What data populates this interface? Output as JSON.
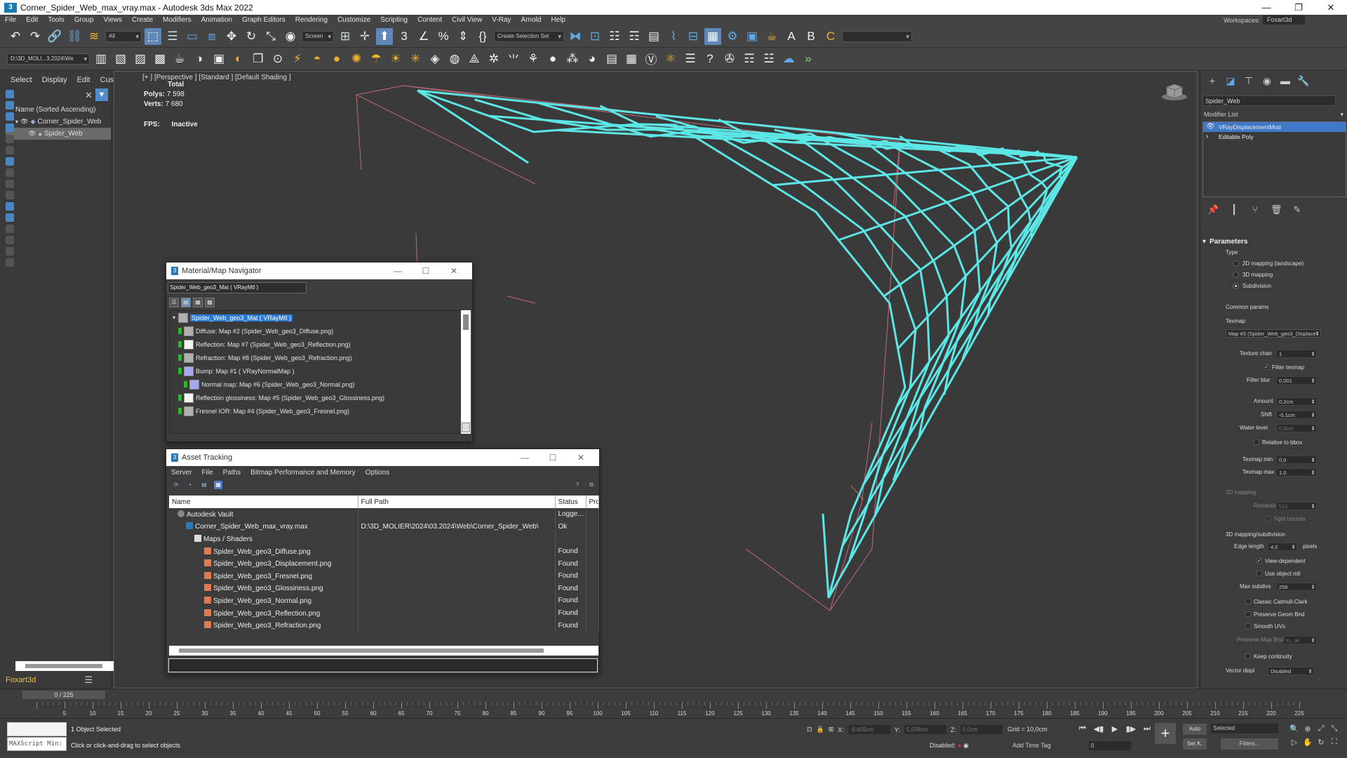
{
  "window": {
    "title": "Corner_Spider_Web_max_vray.max - Autodesk 3ds Max 2022",
    "workspaces_label": "Workspaces:",
    "workspace_value": "Foxart3d"
  },
  "menu": [
    "File",
    "Edit",
    "Tools",
    "Group",
    "Views",
    "Create",
    "Modifiers",
    "Animation",
    "Graph Editors",
    "Rendering",
    "Customize",
    "Scripting",
    "Content",
    "Civil View",
    "V-Ray",
    "Arnold",
    "Help"
  ],
  "toolbar": {
    "filter_all": "All",
    "coord_screen": "Screen",
    "selection_set": "Create Selection Set",
    "path_box": "D:\\3D_MOLI...3.2024\\We"
  },
  "scene_explorer": {
    "tabs": [
      "Select",
      "Display",
      "Edit",
      "Customize"
    ],
    "sort_label": "Name (Sorted Ascending)",
    "items": [
      "Corner_Spider_Web",
      "Spider_Web"
    ],
    "footer": "Foxart3d"
  },
  "viewport": {
    "label": "[+ ] [Perspective ] [Standard ] [Default Shading ]",
    "stats_total": "Total",
    "polys_label": "Polys:",
    "polys_value": "7 598",
    "verts_label": "Verts:",
    "verts_value": "7 680",
    "fps_label": "FPS:",
    "fps_value": "Inactive",
    "wire_color": "#5ce6e6"
  },
  "material_navigator": {
    "title": "Material/Map Navigator",
    "name_box": "Spider_Web_geo3_Mat  ( VRayMtl )",
    "items": [
      "Spider_Web_geo3_Mat  ( VRayMtl )",
      "Diffuse: Map #2 (Spider_Web_geo3_Diffuse.png)",
      "Reflection: Map #7 (Spider_Web_geo3_Reflection.png)",
      "Refraction: Map #8 (Spider_Web_geo3_Refraction.png)",
      "Bump: Map #1  ( VRayNormalMap )",
      "Normal map: Map #6 (Spider_Web_geo3_Normal.png)",
      "Reflection glossiness: Map #5 (Spider_Web_geo3_Glossiness.png)",
      "Fresnel IOR: Map #4 (Spider_Web_geo3_Fresnel.png)"
    ]
  },
  "asset_tracking": {
    "title": "Asset Tracking",
    "menu": [
      "Server",
      "File",
      "Paths",
      "Bitmap Performance and Memory",
      "Options"
    ],
    "columns": [
      "Name",
      "Full Path",
      "Status",
      "Pro"
    ],
    "rows": [
      {
        "name": "Autodesk Vault",
        "path": "",
        "status": "Logge..."
      },
      {
        "name": "Corner_Spider_Web_max_vray.max",
        "path": "D:\\3D_MOLIER\\2024\\03.2024\\Web\\Corner_Spider_Web\\",
        "status": "Ok"
      },
      {
        "name": "Maps / Shaders",
        "path": "",
        "status": ""
      },
      {
        "name": "Spider_Web_geo3_Diffuse.png",
        "path": "",
        "status": "Found"
      },
      {
        "name": "Spider_Web_geo3_Displacement.png",
        "path": "",
        "status": "Found"
      },
      {
        "name": "Spider_Web_geo3_Fresnel.png",
        "path": "",
        "status": "Found"
      },
      {
        "name": "Spider_Web_geo3_Glossiness.png",
        "path": "",
        "status": "Found"
      },
      {
        "name": "Spider_Web_geo3_Normal.png",
        "path": "",
        "status": "Found"
      },
      {
        "name": "Spider_Web_geo3_Reflection.png",
        "path": "",
        "status": "Found"
      },
      {
        "name": "Spider_Web_geo3_Refraction.png",
        "path": "",
        "status": "Found"
      }
    ]
  },
  "command_panel": {
    "object_name": "Spider_Web",
    "modifier_list": "Modifier List",
    "stack": [
      "VRayDisplacementMod",
      "Editable Poly"
    ],
    "parameters": "Parameters",
    "type_label": "Type",
    "type_options": [
      "2D mapping (landscape)",
      "3D mapping",
      "Subdivision"
    ],
    "common_params": "Common params",
    "texmap_label": "Texmap",
    "texmap_value": "Map #3 (Spider_Web_geo3_Displace",
    "texture_chan_label": "Texture chan",
    "texture_chan_value": "1",
    "filter_texmap": "Filter texmap",
    "filter_blur_label": "Filter blur",
    "filter_blur_value": "0,001",
    "amount_label": "Amount",
    "amount_value": "0,2cm",
    "shift_label": "Shift",
    "shift_value": "-0,1cm",
    "water_level_label": "Water level",
    "water_level_value": "0,0cm",
    "relative_bbox": "Relative to bbox",
    "texmap_min_label": "Texmap min",
    "texmap_min_value": "0,0",
    "texmap_max_label": "Texmap max",
    "texmap_max_value": "1,0",
    "mapping2d_label": "2D mapping",
    "resolution_label": "Resolution",
    "resolution_value": "512",
    "tight_bounds": "Tight bounds",
    "mapping3d_label": "3D mapping/subdivision",
    "edge_length_label": "Edge length",
    "edge_length_value": "4,0",
    "pixels_label": "pixels",
    "view_dependent": "View-dependent",
    "use_object_mtl": "Use object mtl",
    "max_subdivs_label": "Max subdivs",
    "max_subdivs_value": "256",
    "classic_catmull": "Classic Catmull-Clark",
    "preserve_geom": "Preserve Geom Bnd",
    "smooth_uvs": "Smooth UVs",
    "preserve_map_label": "Preserve Map Bnd",
    "preserve_map_value": "In...al",
    "keep_continuity": "Keep continuity",
    "vector_displ_label": "Vector displ",
    "vector_displ_value": "Disabled"
  },
  "timeline": {
    "slider": "0 / 225",
    "ticks": [
      "0",
      "5",
      "10",
      "15",
      "20",
      "25",
      "30",
      "35",
      "40",
      "45",
      "50",
      "55",
      "60",
      "65",
      "70",
      "75",
      "80",
      "85",
      "90",
      "95",
      "100",
      "105",
      "110",
      "115",
      "120",
      "125",
      "130",
      "135",
      "140",
      "145",
      "150",
      "155",
      "160",
      "165",
      "170",
      "175",
      "180",
      "185",
      "190",
      "195",
      "200",
      "205",
      "210",
      "215",
      "220",
      "225"
    ]
  },
  "status": {
    "maxscript": "MAXScript Min:",
    "selected": "1 Object Selected",
    "prompt": "Click or click-and-drag to select objects",
    "x_label": "X:",
    "x_value": "-8,605cm",
    "y_label": "Y:",
    "y_value": "5,508cm",
    "z_label": "Z:",
    "z_value": "0,0cm",
    "grid": "Grid = 10,0cm",
    "disabled": "Disabled:",
    "add_time_tag": "Add Time Tag",
    "auto": "Auto",
    "set_k": "Set K.",
    "selected_dd": "Selected",
    "filters": "Filters...",
    "frame_value": "0"
  }
}
